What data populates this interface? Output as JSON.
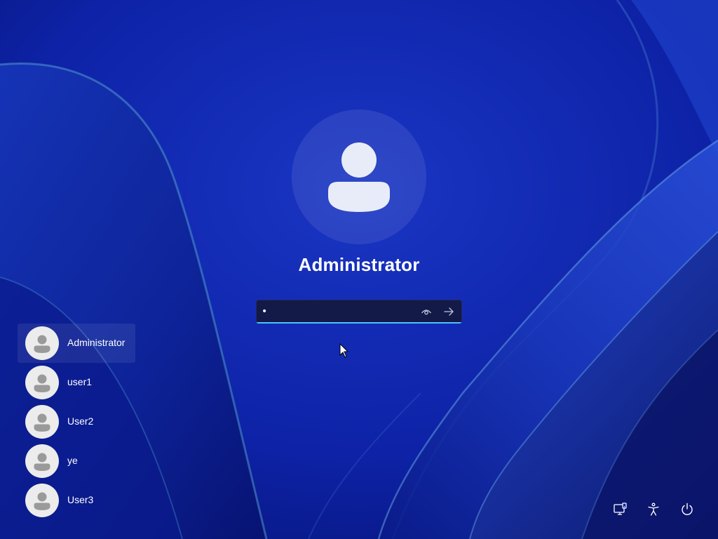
{
  "selected_user": {
    "name": "Administrator",
    "avatar_icon": "user-avatar-icon"
  },
  "password_field": {
    "value": "•",
    "reveal_icon": "eye-icon",
    "submit_icon": "arrow-right-icon"
  },
  "user_list": [
    {
      "name": "Administrator",
      "selected": true
    },
    {
      "name": "user1",
      "selected": false
    },
    {
      "name": "User2",
      "selected": false
    },
    {
      "name": "ye",
      "selected": false
    },
    {
      "name": "User3",
      "selected": false
    }
  ],
  "system_buttons": {
    "network": "network-icon",
    "accessibility": "accessibility-icon",
    "power": "power-icon"
  },
  "colors": {
    "background": "#0a1f9e",
    "accent": "#4cc2ff",
    "text": "#ffffff"
  }
}
